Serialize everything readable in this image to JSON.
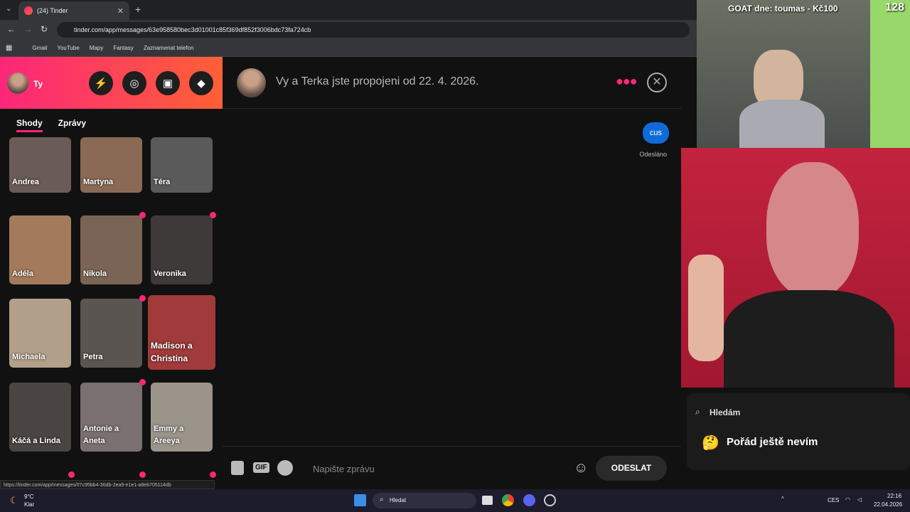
{
  "browser": {
    "tab_title": "(24) Tinder",
    "url": "tinder.com/app/messages/63e958580bec3d01001c85f369df852f3006bdc73fa724cb",
    "bookmarks": [
      "Gmail",
      "YouTube",
      "Mapy",
      "Fantasy",
      "Zaznamenat telefon"
    ],
    "status_url": "https://tinder.com/app/messages/07c95bb4-36db-2ea9-e1e1-a8eb705114db"
  },
  "sidebar": {
    "user_label": "Ty",
    "tabs": [
      "Shody",
      "Zprávy"
    ],
    "matches": [
      {
        "name": "Andrea",
        "color": "#6b5b56"
      },
      {
        "name": "Martyna",
        "color": "#8a6a55"
      },
      {
        "name": "Téra",
        "color": "#5a5a5a"
      },
      {
        "name": "Adéla",
        "color": "#a47a5c"
      },
      {
        "name": "Nikola",
        "color": "#7a6455"
      },
      {
        "name": "Veronika",
        "color": "#3f3a3a"
      },
      {
        "name": "Michaela",
        "color": "#b3a08a"
      },
      {
        "name": "Petra",
        "color": "#5a5550"
      },
      {
        "name": "Madison a Christina",
        "color": "#a13a3a"
      },
      {
        "name": "Káčá a Linda",
        "color": "#4a4543"
      },
      {
        "name": "Antonie a Aneta",
        "color": "#7a7070"
      },
      {
        "name": "Emmy a Areeya",
        "color": "#9a948a"
      }
    ]
  },
  "chat": {
    "header": "Vy a Terka jste propojeni od 22. 4. 2026.",
    "message": "cus",
    "status": "Odesláno",
    "placeholder": "Napište zprávu",
    "send": "ODESLAT",
    "gif": "GIF"
  },
  "overlay": {
    "goat": "GOAT dne: toumas - Kč100",
    "count": "128",
    "looking_label": "Hledám",
    "looking_value": "Pořád ještě nevím"
  },
  "taskbar": {
    "weather_temp": "9°C",
    "weather_desc": "Klar",
    "search": "Hledat",
    "lang": "CES",
    "time": "22:16",
    "date": "22.04.2026"
  }
}
